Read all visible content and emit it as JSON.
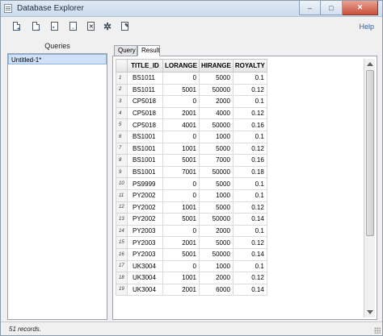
{
  "window": {
    "title": "Database Explorer",
    "controls": [
      {
        "name": "minimize-button",
        "symbol": "–"
      },
      {
        "name": "maximize-button",
        "symbol": "□"
      },
      {
        "name": "close-button",
        "symbol": "✕"
      }
    ]
  },
  "toolbar": {
    "buttons": [
      {
        "name": "new-query-icon",
        "mark": "+"
      },
      {
        "name": "open-query-icon",
        "mark": "→"
      },
      {
        "name": "save-query-icon",
        "mark": "▪"
      },
      {
        "name": "copy-query-icon",
        "mark": "▫"
      },
      {
        "name": "delete-query-icon",
        "mark": "✕"
      },
      {
        "name": "run-query-icon",
        "mark": "✲"
      },
      {
        "name": "edit-query-icon",
        "mark": "✎"
      }
    ],
    "help_label": "Help"
  },
  "queries": {
    "header": "Queries",
    "items": [
      "Untitled-1*"
    ]
  },
  "tabs": {
    "query_label": "Query",
    "result_label": "Result",
    "active": "Result"
  },
  "result": {
    "columns": [
      "TITLE_ID",
      "LORANGE",
      "HIRANGE",
      "ROYALTY"
    ],
    "rows": [
      [
        "1",
        "BS1011",
        "0",
        "5000",
        "0.1"
      ],
      [
        "2",
        "BS1011",
        "5001",
        "50000",
        "0.12"
      ],
      [
        "3",
        "CP5018",
        "0",
        "2000",
        "0.1"
      ],
      [
        "4",
        "CP5018",
        "2001",
        "4000",
        "0.12"
      ],
      [
        "5",
        "CP5018",
        "4001",
        "50000",
        "0.16"
      ],
      [
        "6",
        "BS1001",
        "0",
        "1000",
        "0.1"
      ],
      [
        "7",
        "BS1001",
        "1001",
        "5000",
        "0.12"
      ],
      [
        "8",
        "BS1001",
        "5001",
        "7000",
        "0.16"
      ],
      [
        "9",
        "BS1001",
        "7001",
        "50000",
        "0.18"
      ],
      [
        "10",
        "PS9999",
        "0",
        "5000",
        "0.1"
      ],
      [
        "11",
        "PY2002",
        "0",
        "1000",
        "0.1"
      ],
      [
        "12",
        "PY2002",
        "1001",
        "5000",
        "0.12"
      ],
      [
        "13",
        "PY2002",
        "5001",
        "50000",
        "0.14"
      ],
      [
        "14",
        "PY2003",
        "0",
        "2000",
        "0.1"
      ],
      [
        "15",
        "PY2003",
        "2001",
        "5000",
        "0.12"
      ],
      [
        "16",
        "PY2003",
        "5001",
        "50000",
        "0.14"
      ],
      [
        "17",
        "UK3004",
        "0",
        "1000",
        "0.1"
      ],
      [
        "18",
        "UK3004",
        "1001",
        "2000",
        "0.12"
      ],
      [
        "19",
        "UK3004",
        "2001",
        "6000",
        "0.14"
      ]
    ]
  },
  "status": {
    "text": "51 records."
  }
}
